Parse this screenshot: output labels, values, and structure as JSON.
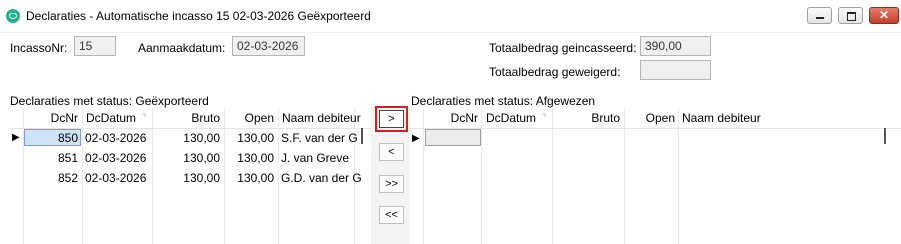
{
  "window": {
    "title": "Declaraties - Automatische incasso  15 02-03-2026 Geëxporteerd",
    "close_glyph": "✕"
  },
  "header": {
    "incassonr_label": "IncassoNr:",
    "incassonr_value": "15",
    "aanmaakdatum_label": "Aanmaakdatum:",
    "aanmaakdatum_value": "02-03-2026",
    "totaal_geincasseerd_label": "Totaalbedrag geincasseerd:",
    "totaal_geincasseerd_value": "390,00",
    "totaal_geweigerd_label": "Totaalbedrag geweigerd:",
    "totaal_geweigerd_value": ""
  },
  "left_grid": {
    "caption": "Declaraties met status: Geëxporteerd",
    "columns": [
      "DcNr",
      "DcDatum",
      "Bruto",
      "Open",
      "Naam debiteur"
    ],
    "rows": [
      {
        "dcnr": "850",
        "datum": "02-03-2026",
        "bruto": "130,00",
        "open": "130,00",
        "naam": "S.F. van der G"
      },
      {
        "dcnr": "851",
        "datum": "02-03-2026",
        "bruto": "130,00",
        "open": "130,00",
        "naam": "J. van Greve"
      },
      {
        "dcnr": "852",
        "datum": "02-03-2026",
        "bruto": "130,00",
        "open": "130,00",
        "naam": "G.D. van der G"
      }
    ]
  },
  "right_grid": {
    "caption": "Declaraties met status: Afgewezen",
    "columns": [
      "DcNr",
      "DcDatum",
      "Bruto",
      "Open",
      "Naam debiteur"
    ]
  },
  "transfer_buttons": {
    "move_right": ">",
    "move_left": "<",
    "move_all_right": ">>",
    "move_all_left": "<<"
  },
  "icons": {
    "row_pointer": "▶",
    "sort_indicator": "▿"
  }
}
